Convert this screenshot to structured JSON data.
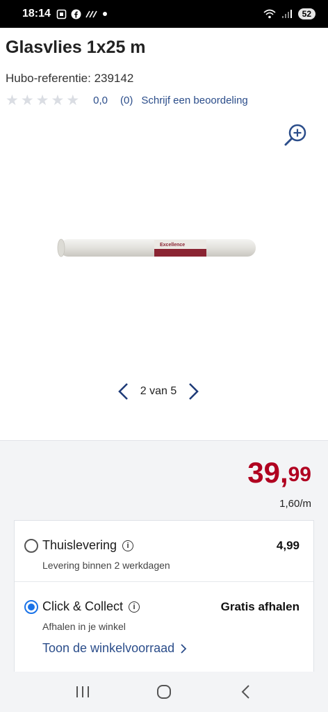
{
  "status_bar": {
    "time": "18:14",
    "battery": "52",
    "icons": [
      "screenshot-icon",
      "facebook-icon",
      "activity-icon",
      "notification-dot",
      "wifi-icon",
      "signal-icon"
    ]
  },
  "product": {
    "title": "Glasvlies 1x25 m",
    "reference": "Hubo-referentie: 239142",
    "rating_value": "0,0",
    "rating_count": "(0)",
    "write_review": "Schrijf een beoordeling",
    "stars_filled": 0,
    "stars_total": 5,
    "image_label": "Excellence"
  },
  "gallery": {
    "pager_text": "2 van 5"
  },
  "price": {
    "main": "39,",
    "decimals": "99",
    "unit_price": "1,60/m",
    "color": "#b00020"
  },
  "delivery": {
    "options": [
      {
        "label": "Thuislevering",
        "sub": "Levering binnen 2 werkdagen",
        "price": "4,99",
        "selected": false
      },
      {
        "label": "Click & Collect",
        "sub": "Afhalen in je winkel",
        "price": "Gratis afhalen",
        "selected": true,
        "link": "Toon de winkelvoorraad"
      }
    ]
  },
  "colors": {
    "accent": "#2b4d8a",
    "radio_selected": "#1a73e8"
  }
}
